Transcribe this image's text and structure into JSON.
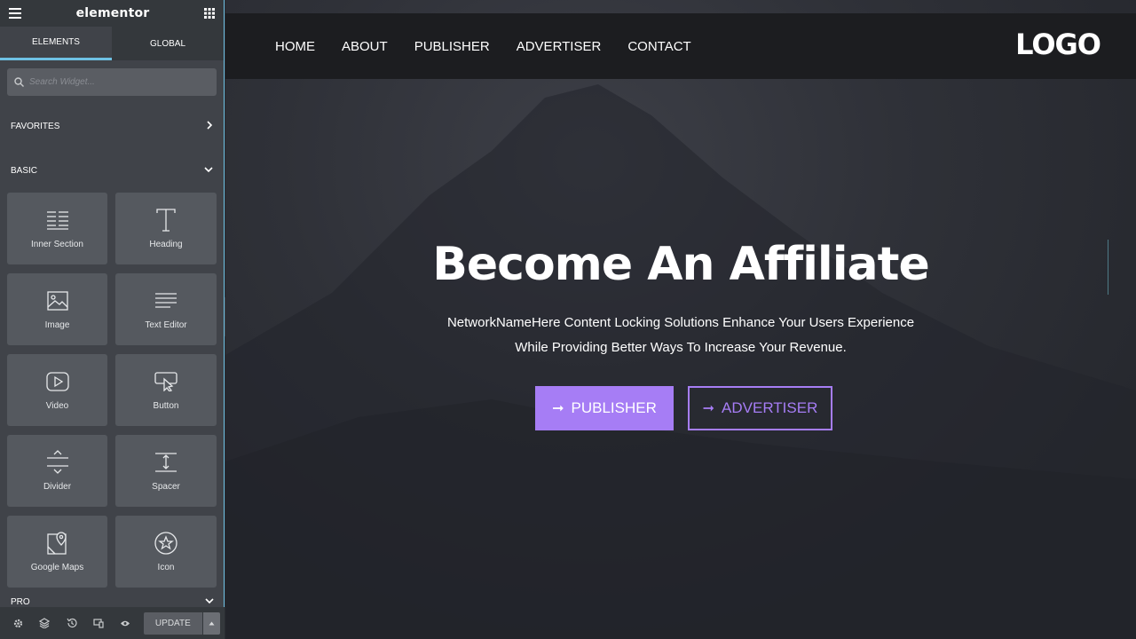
{
  "sidebar": {
    "brand": "elementor",
    "tabs": [
      "ELEMENTS",
      "GLOBAL"
    ],
    "search_placeholder": "Search Widget...",
    "sections": {
      "favorites": "FAVORITES",
      "basic": "BASIC",
      "pro": "PRO"
    },
    "widgets": [
      {
        "label": "Inner Section",
        "icon": "inner-section-icon"
      },
      {
        "label": "Heading",
        "icon": "heading-icon"
      },
      {
        "label": "Image",
        "icon": "image-icon"
      },
      {
        "label": "Text Editor",
        "icon": "text-editor-icon"
      },
      {
        "label": "Video",
        "icon": "video-icon"
      },
      {
        "label": "Button",
        "icon": "button-icon"
      },
      {
        "label": "Divider",
        "icon": "divider-icon"
      },
      {
        "label": "Spacer",
        "icon": "spacer-icon"
      },
      {
        "label": "Google Maps",
        "icon": "google-maps-icon"
      },
      {
        "label": "Icon",
        "icon": "star-icon"
      }
    ],
    "footer": {
      "update_label": "UPDATE"
    }
  },
  "page": {
    "nav": [
      "HOME",
      "ABOUT",
      "PUBLISHER",
      "ADVERTISER",
      "CONTACT"
    ],
    "logo": "LOGO",
    "hero_title": "Become An Affiliate",
    "hero_sub_line1": "NetworkNameHere Content Locking Solutions Enhance Your Users Experience",
    "hero_sub_line2": "While Providing Better Ways To Increase Your Revenue.",
    "btn_publisher": "PUBLISHER",
    "btn_advertiser": "ADVERTISER"
  },
  "colors": {
    "accent": "#a67df5",
    "editor_accent": "#6ec1e4"
  }
}
